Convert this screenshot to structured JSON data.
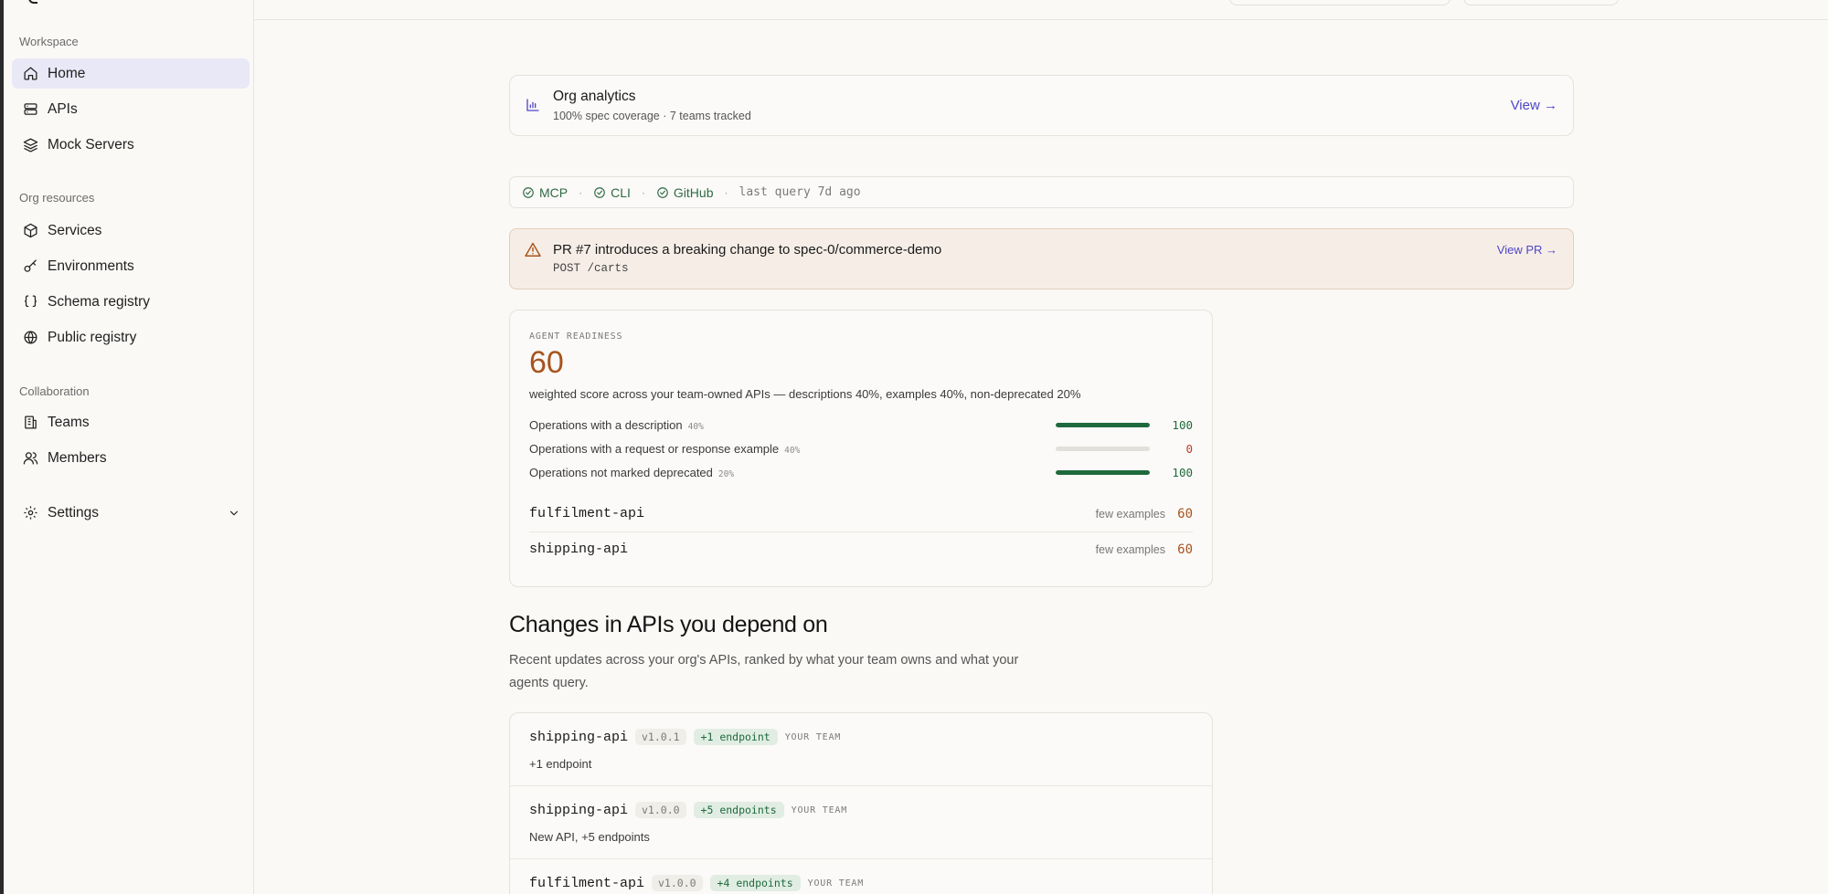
{
  "colors": {
    "accent": "#4f46c8",
    "good": "#1f6a3d",
    "warn": "#a8541e",
    "bad": "#c0392b"
  },
  "sidebar": {
    "sections": [
      {
        "label": "Workspace",
        "items": [
          {
            "label": "Home",
            "icon": "home-icon",
            "active": true
          },
          {
            "label": "APIs",
            "icon": "server-icon"
          },
          {
            "label": "Mock Servers",
            "icon": "layers-icon"
          }
        ]
      },
      {
        "label": "Org resources",
        "items": [
          {
            "label": "Services",
            "icon": "box-icon"
          },
          {
            "label": "Environments",
            "icon": "key-icon"
          },
          {
            "label": "Schema registry",
            "icon": "braces-icon"
          },
          {
            "label": "Public registry",
            "icon": "globe-icon"
          }
        ]
      },
      {
        "label": "Collaboration",
        "items": [
          {
            "label": "Teams",
            "icon": "building-icon"
          },
          {
            "label": "Members",
            "icon": "users-icon"
          }
        ]
      }
    ],
    "settings": {
      "label": "Settings",
      "icon": "gear-icon"
    }
  },
  "analytics": {
    "title": "Org analytics",
    "subtitle": "100% spec coverage · 7 teams tracked",
    "link": "View →"
  },
  "integrations": {
    "items": [
      "MCP",
      "CLI",
      "GitHub"
    ],
    "separator": "·",
    "last_query": "last query 7d ago"
  },
  "alert": {
    "title": "PR #7 introduces a breaking change to spec-0/commerce-demo",
    "endpoint": "POST /carts",
    "link": "View PR →"
  },
  "readiness": {
    "label": "AGENT READINESS",
    "score": "60",
    "description": "weighted score across your team-owned APIs — descriptions 40%, examples 40%, non-deprecated 20%",
    "metrics": [
      {
        "label": "Operations with a description",
        "weight": "40%",
        "value": "100",
        "fraction": 1.0
      },
      {
        "label": "Operations with a request or response example",
        "weight": "40%",
        "value": "0",
        "fraction": 0.0
      },
      {
        "label": "Operations not marked deprecated",
        "weight": "20%",
        "value": "100",
        "fraction": 1.0
      }
    ],
    "apis": [
      {
        "name": "fulfilment-api",
        "note": "few examples",
        "score": "60"
      },
      {
        "name": "shipping-api",
        "note": "few examples",
        "score": "60"
      }
    ]
  },
  "changes": {
    "heading": "Changes in APIs you depend on",
    "lead": "Recent updates across your org's APIs, ranked by what your team owns and what your agents query.",
    "items": [
      {
        "name": "shipping-api",
        "version": "v1.0.1",
        "diff": "+1 endpoint",
        "owner": "YOUR TEAM",
        "summary": "+1 endpoint"
      },
      {
        "name": "shipping-api",
        "version": "v1.0.0",
        "diff": "+5 endpoints",
        "owner": "YOUR TEAM",
        "summary": "New API, +5 endpoints"
      },
      {
        "name": "fulfilment-api",
        "version": "v1.0.0",
        "diff": "+4 endpoints",
        "owner": "YOUR TEAM",
        "summary": ""
      }
    ]
  }
}
